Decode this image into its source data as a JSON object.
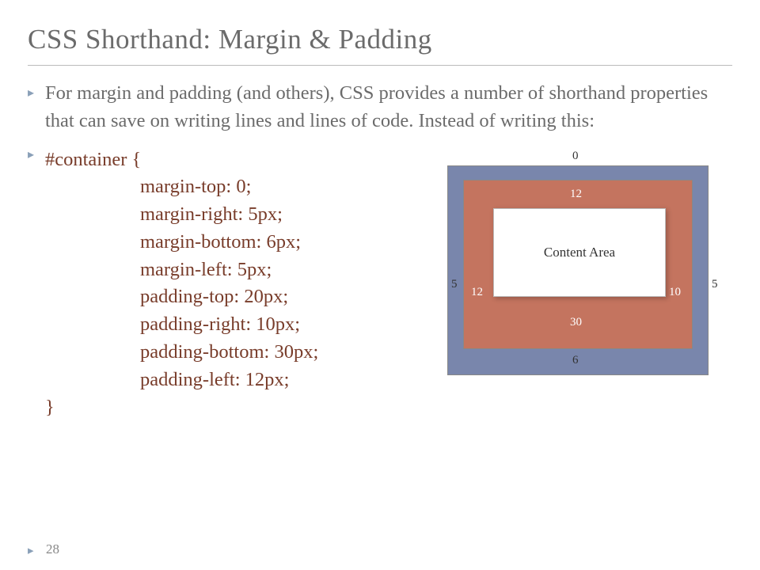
{
  "title": "CSS Shorthand: Margin & Padding",
  "intro": "For margin and padding (and others), CSS provides a number of shorthand properties that can save on writing lines and lines of code. Instead of writing this:",
  "code": {
    "selector_open": "#container {",
    "l1": "margin-top: 0;",
    "l2": "margin-right: 5px;",
    "l3": "margin-bottom: 6px;",
    "l4": "margin-left: 5px;",
    "l5": "padding-top: 20px;",
    "l6": "padding-right: 10px;",
    "l7": "padding-bottom: 30px;",
    "l8": "padding-left: 12px;",
    "close": "}"
  },
  "diagram": {
    "margin_top": "0",
    "margin_right": "5",
    "margin_bottom": "6",
    "margin_left": "5",
    "padding_top": "12",
    "padding_right": "10",
    "padding_bottom": "30",
    "padding_left": "12",
    "content_label": "Content Area"
  },
  "page_number": "28"
}
